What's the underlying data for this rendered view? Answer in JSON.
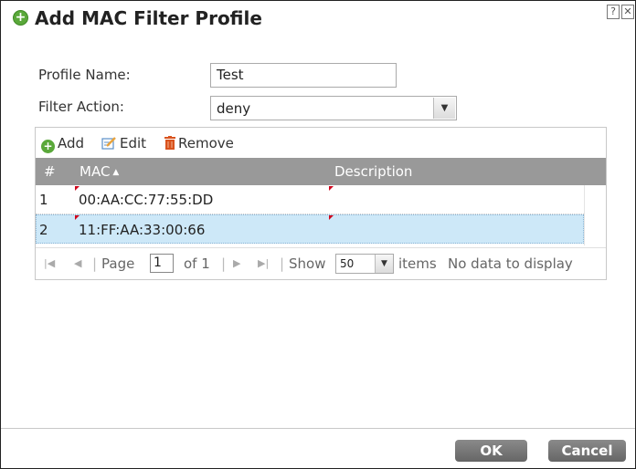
{
  "dialog": {
    "title": "Add MAC Filter Profile",
    "help_glyph": "?",
    "close_glyph": "✕"
  },
  "form": {
    "profile_name_label": "Profile Name:",
    "profile_name_value": "Test",
    "filter_action_label": "Filter Action:",
    "filter_action_value": "deny"
  },
  "toolbar": {
    "add_label": "Add",
    "edit_label": "Edit",
    "remove_label": "Remove"
  },
  "grid": {
    "columns": [
      "#",
      "MAC",
      "Description"
    ],
    "sort_indicator": "▲",
    "rows": [
      {
        "num": "1",
        "mac": "00:AA:CC:77:55:DD",
        "description": "",
        "selected": false
      },
      {
        "num": "2",
        "mac": "11:FF:AA:33:00:66",
        "description": "",
        "selected": true
      }
    ]
  },
  "pager": {
    "page_label": "Page",
    "page_value": "1",
    "of_label": "of 1",
    "show_label": "Show",
    "show_value": "50",
    "items_label": "items",
    "status": "No data to display"
  },
  "footer": {
    "ok_label": "OK",
    "cancel_label": "Cancel"
  },
  "colors": {
    "header_bg": "#999999",
    "selected_row": "#cde8f8",
    "button_bg": "#777777",
    "add_icon": "#5aa83a",
    "remove_icon": "#d9531e"
  }
}
